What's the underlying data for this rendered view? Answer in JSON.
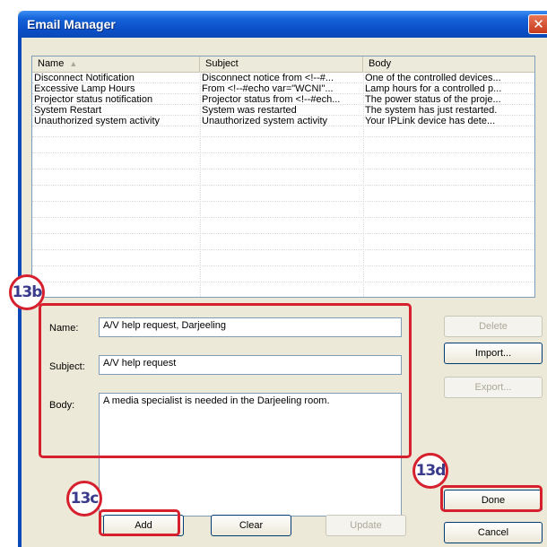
{
  "window": {
    "title": "Email Manager",
    "close_glyph": "✕"
  },
  "list": {
    "columns": [
      "Name",
      "Subject",
      "Body"
    ],
    "rows": [
      {
        "name": "Disconnect Notification",
        "subject": "Disconnect notice from <!--#...",
        "body": "One of the controlled devices..."
      },
      {
        "name": "Excessive Lamp Hours",
        "subject": "From <!--#echo var=\"WCNI\"...",
        "body": "Lamp hours for a controlled p..."
      },
      {
        "name": "Projector status notification",
        "subject": "Projector status from <!--#ech...",
        "body": "The power status of the proje..."
      },
      {
        "name": "System Restart",
        "subject": "System was restarted",
        "body": "The system has just restarted."
      },
      {
        "name": "Unauthorized system activity",
        "subject": "Unauthorized system activity",
        "body": "Your IPLink device has dete..."
      }
    ]
  },
  "form": {
    "name_label": "Name:",
    "name_value": "A/V help request, Darjeeling",
    "subject_label": "Subject:",
    "subject_value": "A/V help request",
    "body_label": "Body:",
    "body_value": "A media specialist is needed in the Darjeeling room."
  },
  "buttons": {
    "delete": "Delete",
    "import": "Import...",
    "export": "Export...",
    "done": "Done",
    "cancel": "Cancel",
    "add": "Add",
    "clear": "Clear",
    "update": "Update"
  },
  "callouts": {
    "b": "13b",
    "c": "13c",
    "d": "13d"
  },
  "colors": {
    "callout_red": "#d6202e",
    "title_blue": "#0b4fc7",
    "dialog_bg": "#ece9d8"
  }
}
